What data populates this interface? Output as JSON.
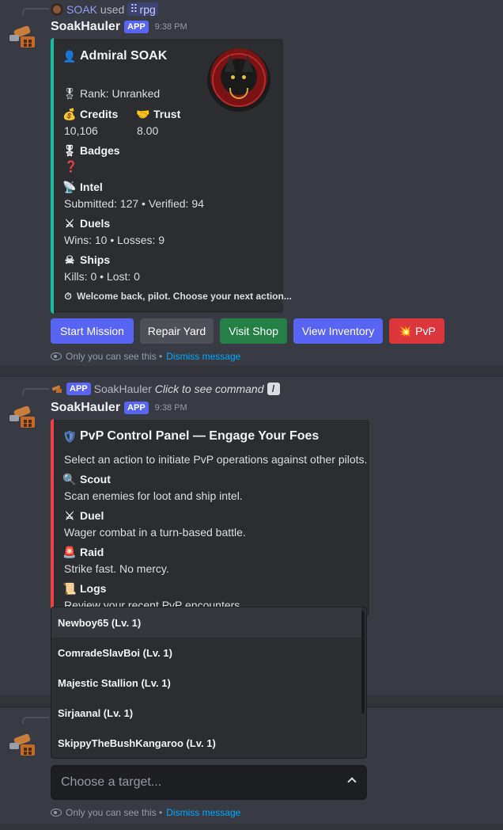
{
  "message1": {
    "reply": {
      "user": "SOAK",
      "used": "used",
      "command": "rpg"
    },
    "author": "SoakHauler",
    "tag": "APP",
    "time": "9:38 PM",
    "embed": {
      "title": "Admiral SOAK",
      "title_icon": "pilot-icon",
      "rank": "Rank: Unranked",
      "credits_label": "Credits",
      "credits_value": "10,106",
      "trust_label": "Trust",
      "trust_value": "8.00",
      "badges_label": "Badges",
      "badges_value": "❓",
      "intel_label": "Intel",
      "intel_value": "Submitted: 127 • Verified: 94",
      "duels_label": "Duels",
      "duels_value": "Wins: 10 • Losses: 9",
      "ships_label": "Ships",
      "ships_value": "Kills: 0 • Lost: 0",
      "footer": "Welcome back, pilot. Choose your next action...",
      "bar_color": "#1abc9c"
    },
    "buttons": {
      "start": "Start Mission",
      "repair": "Repair Yard",
      "shop": "Visit Shop",
      "inventory": "View Inventory",
      "pvp": "PvP"
    },
    "ephemeral": {
      "text": "Only you can see this •",
      "dismiss": "Dismiss message"
    }
  },
  "message2": {
    "reply": {
      "tag": "APP",
      "user": "SoakHauler",
      "hint": "Click to see command"
    },
    "author": "SoakHauler",
    "tag": "APP",
    "time": "9:38 PM",
    "embed": {
      "title": "PvP Control Panel — Engage Your Foes",
      "desc": "Select an action to initiate PvP operations against other pilots.",
      "scout_label": "Scout",
      "scout_value": "Scan enemies for loot and ship intel.",
      "duel_label": "Duel",
      "duel_value": "Wager combat in a turn-based battle.",
      "raid_label": "Raid",
      "raid_value": "Strike fast. No mercy.",
      "logs_label": "Logs",
      "logs_value": "Review your recent PvP encounters.",
      "bar_color": "#ed4245"
    }
  },
  "message3": {
    "select_placeholder": "Choose a target...",
    "options": [
      "Newboy65 (Lv. 1)",
      "ComradeSlavBoi (Lv. 1)",
      "Majestic Stallion (Lv. 1)",
      "Sirjaanal (Lv. 1)",
      "SkippyTheBushKangaroo (Lv. 1)"
    ],
    "ephemeral": {
      "text": "Only you can see this •",
      "dismiss": "Dismiss message"
    }
  },
  "colors": {
    "blurple": "#5865f2",
    "secondary": "#4e5058",
    "success": "#248046",
    "danger": "#da373c"
  }
}
